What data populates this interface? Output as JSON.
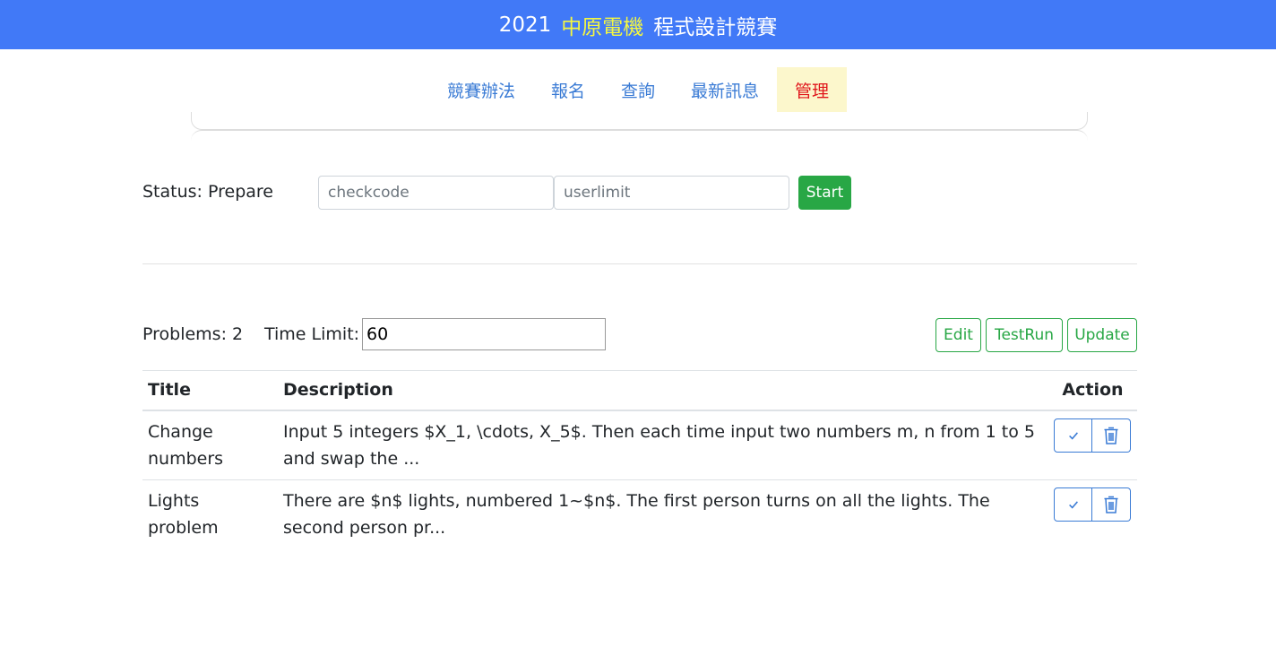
{
  "header": {
    "year": "2021",
    "highlight": "中原電機",
    "title_rest": "程式設計競賽"
  },
  "nav": {
    "items": [
      {
        "label": "競賽辦法",
        "active": false
      },
      {
        "label": "報名",
        "active": false
      },
      {
        "label": "查詢",
        "active": false
      },
      {
        "label": "最新訊息",
        "active": false
      },
      {
        "label": "管理",
        "active": true
      }
    ]
  },
  "status": {
    "label": "Status: Prepare",
    "checkcode_placeholder": "checkcode",
    "userlimit_placeholder": "userlimit",
    "start_label": "Start"
  },
  "problems": {
    "count_label": "Problems: 2",
    "time_limit_label": "Time Limit:",
    "time_limit_value": "60",
    "edit_label": "Edit",
    "testrun_label": "TestRun",
    "update_label": "Update"
  },
  "table": {
    "headers": {
      "title": "Title",
      "description": "Description",
      "action": "Action"
    },
    "rows": [
      {
        "title": "Change numbers",
        "description": "Input 5 integers $X_1, \\cdots, X_5$. Then each time input two numbers m, n from 1 to 5 and swap the ..."
      },
      {
        "title": "Lights problem",
        "description": "There are $n$ lights, numbered 1~$n$. The first person turns on all the lights. The second person pr..."
      }
    ]
  },
  "icons": {
    "check": "check-icon",
    "trash": "trash-icon"
  },
  "colors": {
    "header_bg": "#4179f7",
    "header_highlight": "#f4f741",
    "nav_link": "#3a7bd5",
    "nav_active_bg": "#fcf7cc",
    "nav_active_text": "#e0161b",
    "success": "#28a745"
  }
}
